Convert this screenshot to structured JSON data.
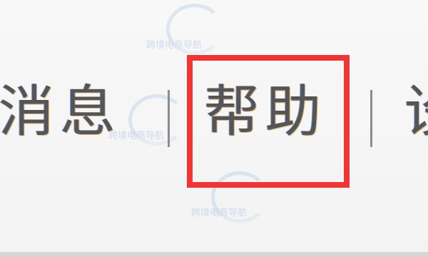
{
  "nav": {
    "messages_label": "消息",
    "help_label": "帮助",
    "next_partial_label": "设"
  },
  "watermark": {
    "text": "跨境电商导航"
  },
  "colors": {
    "highlight_border": "#ef3535",
    "nav_text": "#555555",
    "separator": "#8c8c8c",
    "background": "#f7f7f7"
  }
}
